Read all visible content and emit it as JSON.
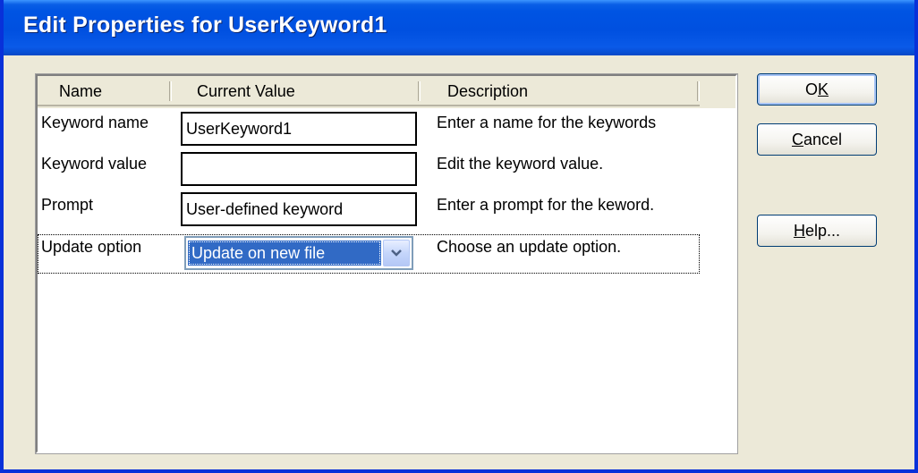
{
  "window": {
    "title": "Edit Properties for UserKeyword1"
  },
  "list": {
    "columns": {
      "name": "Name",
      "current_value": "Current Value",
      "description": "Description"
    },
    "rows": [
      {
        "name": "Keyword name",
        "value": "UserKeyword1",
        "description": "Enter a name for the keywords"
      },
      {
        "name": "Keyword value",
        "value": "",
        "description": "Edit the keyword value."
      },
      {
        "name": "Prompt",
        "value": "User-defined keyword",
        "description": "Enter a prompt for the keword."
      },
      {
        "name": "Update option",
        "value": "Update on new file",
        "description": "Choose an update option."
      }
    ]
  },
  "buttons": {
    "ok": {
      "before": "O",
      "mnemonic": "K",
      "after": ""
    },
    "cancel": {
      "before": "",
      "mnemonic": "C",
      "after": "ancel"
    },
    "help": {
      "before": "",
      "mnemonic": "H",
      "after": "elp..."
    }
  },
  "icons": {
    "dropdown": "chevron-down-icon"
  },
  "colors": {
    "title_bar": "#0054e3",
    "selection": "#316ac5",
    "dialog_bg": "#ece9d8"
  }
}
